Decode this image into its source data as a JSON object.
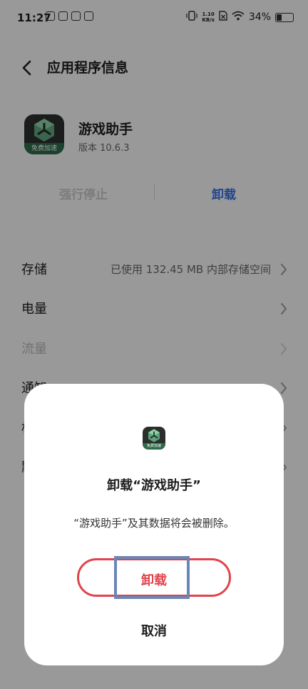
{
  "status_bar": {
    "time": "11:27",
    "net_speed_value": "1.10",
    "net_speed_unit": "KB/s",
    "battery": "34%",
    "battery_level": 0.34
  },
  "header": {
    "back_icon": "chevron-left-icon",
    "title": "应用程序信息"
  },
  "app": {
    "name": "游戏助手",
    "version": "版本 10.6.3",
    "icon_badge": "免费加速"
  },
  "actions": {
    "force_stop": "强行停止",
    "uninstall": "卸载"
  },
  "settings": [
    {
      "label": "存储",
      "value": "已使用 132.45 MB 内部存储空间"
    },
    {
      "label": "电量",
      "value": ""
    },
    {
      "label": "流量",
      "value": ""
    },
    {
      "label": "通知",
      "value": ""
    },
    {
      "label": "权限",
      "value": ""
    },
    {
      "label": "默认",
      "value": ""
    }
  ],
  "dialog": {
    "icon_badge": "免费加速",
    "title": "卸载“游戏助手”",
    "message": "“游戏助手”及其数据将会被删除。",
    "confirm": "卸载",
    "cancel": "取消"
  },
  "colors": {
    "accent_blue": "#3470e4",
    "danger_red": "#e0444c",
    "icon_green": "#2e6b4a"
  }
}
